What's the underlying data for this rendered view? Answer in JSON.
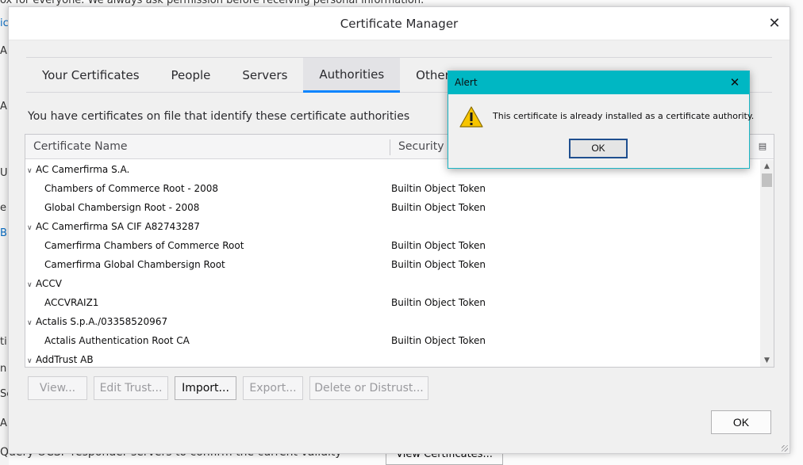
{
  "background": {
    "top_line": "ox for everyone. We always ask permission before receiving personal information.",
    "fragments": [
      {
        "text": "ic",
        "link": true
      },
      {
        "text": "A",
        "link": false
      },
      {
        "text": "A",
        "link": false
      },
      {
        "text": "U",
        "link": false
      },
      {
        "text": "e",
        "link": false
      },
      {
        "text": "B",
        "link": true
      },
      {
        "text": "ti",
        "link": false
      },
      {
        "text": "n",
        "link": false
      },
      {
        "text": "Se",
        "link": false
      },
      {
        "text": "A",
        "link": false
      }
    ],
    "bottom_text": "Query OCSP responder servers to confirm the current validity of",
    "view_certificates_button": "View Certificates..."
  },
  "dialog": {
    "title": "Certificate Manager",
    "close_icon": "close-icon",
    "tabs": [
      {
        "label": "Your Certificates",
        "selected": false
      },
      {
        "label": "People",
        "selected": false
      },
      {
        "label": "Servers",
        "selected": false
      },
      {
        "label": "Authorities",
        "selected": true
      },
      {
        "label": "Others",
        "selected": false
      }
    ],
    "description": "You have certificates on file that identify these certificate authorities",
    "columns": {
      "name": "Certificate Name",
      "token": "Security Device"
    },
    "rows": [
      {
        "type": "group",
        "name": "AC Camerfirma S.A.",
        "token": ""
      },
      {
        "type": "child",
        "name": "Chambers of Commerce Root - 2008",
        "token": "Builtin Object Token"
      },
      {
        "type": "child",
        "name": "Global Chambersign Root - 2008",
        "token": "Builtin Object Token"
      },
      {
        "type": "group",
        "name": "AC Camerfirma SA CIF A82743287",
        "token": ""
      },
      {
        "type": "child",
        "name": "Camerfirma Chambers of Commerce Root",
        "token": "Builtin Object Token"
      },
      {
        "type": "child",
        "name": "Camerfirma Global Chambersign Root",
        "token": "Builtin Object Token"
      },
      {
        "type": "group",
        "name": "ACCV",
        "token": ""
      },
      {
        "type": "child",
        "name": "ACCVRAIZ1",
        "token": "Builtin Object Token"
      },
      {
        "type": "group",
        "name": "Actalis S.p.A./03358520967",
        "token": ""
      },
      {
        "type": "child",
        "name": "Actalis Authentication Root CA",
        "token": "Builtin Object Token"
      },
      {
        "type": "group",
        "name": "AddTrust AB",
        "token": ""
      }
    ],
    "buttons": {
      "view": "View...",
      "edit_trust": "Edit Trust...",
      "import": "Import...",
      "export": "Export...",
      "delete": "Delete or Distrust...",
      "ok": "OK"
    }
  },
  "alert": {
    "title": "Alert",
    "message": "This certificate is already installed as a certificate authority.",
    "ok_label": "OK",
    "icon": "warning-icon",
    "title_bar_color": "#00b7c3"
  },
  "colors": {
    "tab_accent": "#0a84ff",
    "alert_title": "#00b7c3"
  }
}
